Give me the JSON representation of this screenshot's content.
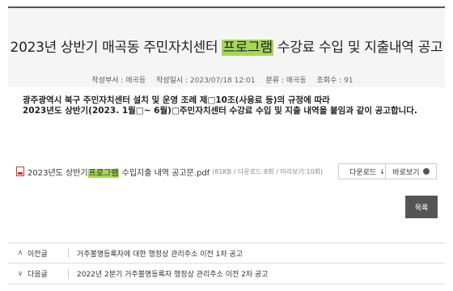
{
  "header": {
    "title_before": "2023년 상반기 매곡동 주민자치센터 ",
    "title_highlight": "프로그램",
    "title_after": " 수강료 수입 및 지출내역 공고",
    "meta": [
      {
        "key": "작성부서 :",
        "value": "매곡동"
      },
      {
        "key": "작성일시 :",
        "value": "2023/07/18 12:01"
      },
      {
        "key": "분류 :",
        "value": "매곡동"
      },
      {
        "key": "조회수 :",
        "value": "91"
      }
    ]
  },
  "body": {
    "line1": "광주광역시 북구 주민자치센터 설치 및 운영 조례 제□10조(사용료 등)의 규정에 따라",
    "line2": "2023년도 상반기(2023. 1월□~ 6월)□주민자치센터 수강료 수입 및 지출 내역을 붙임과 같이 공고합니다."
  },
  "attachment": {
    "name_before": "2023년도 상반기",
    "name_highlight": "프로그램",
    "name_after": " 수입지출 내역 공고문.pdf",
    "info": "(81KB / 다운로드:8회 / 미리보기:10회)",
    "download_label": "다운로드",
    "preview_label": "바로보기"
  },
  "list_button": "목록",
  "nav": {
    "prev_label": "이전글",
    "prev_title": "거주불명등록자에 대한 행정상 관리주소 이전 1차 공고",
    "next_label": "다음글",
    "next_title": "2022년 2분기 거주불명등록자 행정상 관리주소 이전 2차 공고"
  },
  "colors": {
    "highlight": "#a6d65a",
    "list_button_bg": "#555555"
  }
}
